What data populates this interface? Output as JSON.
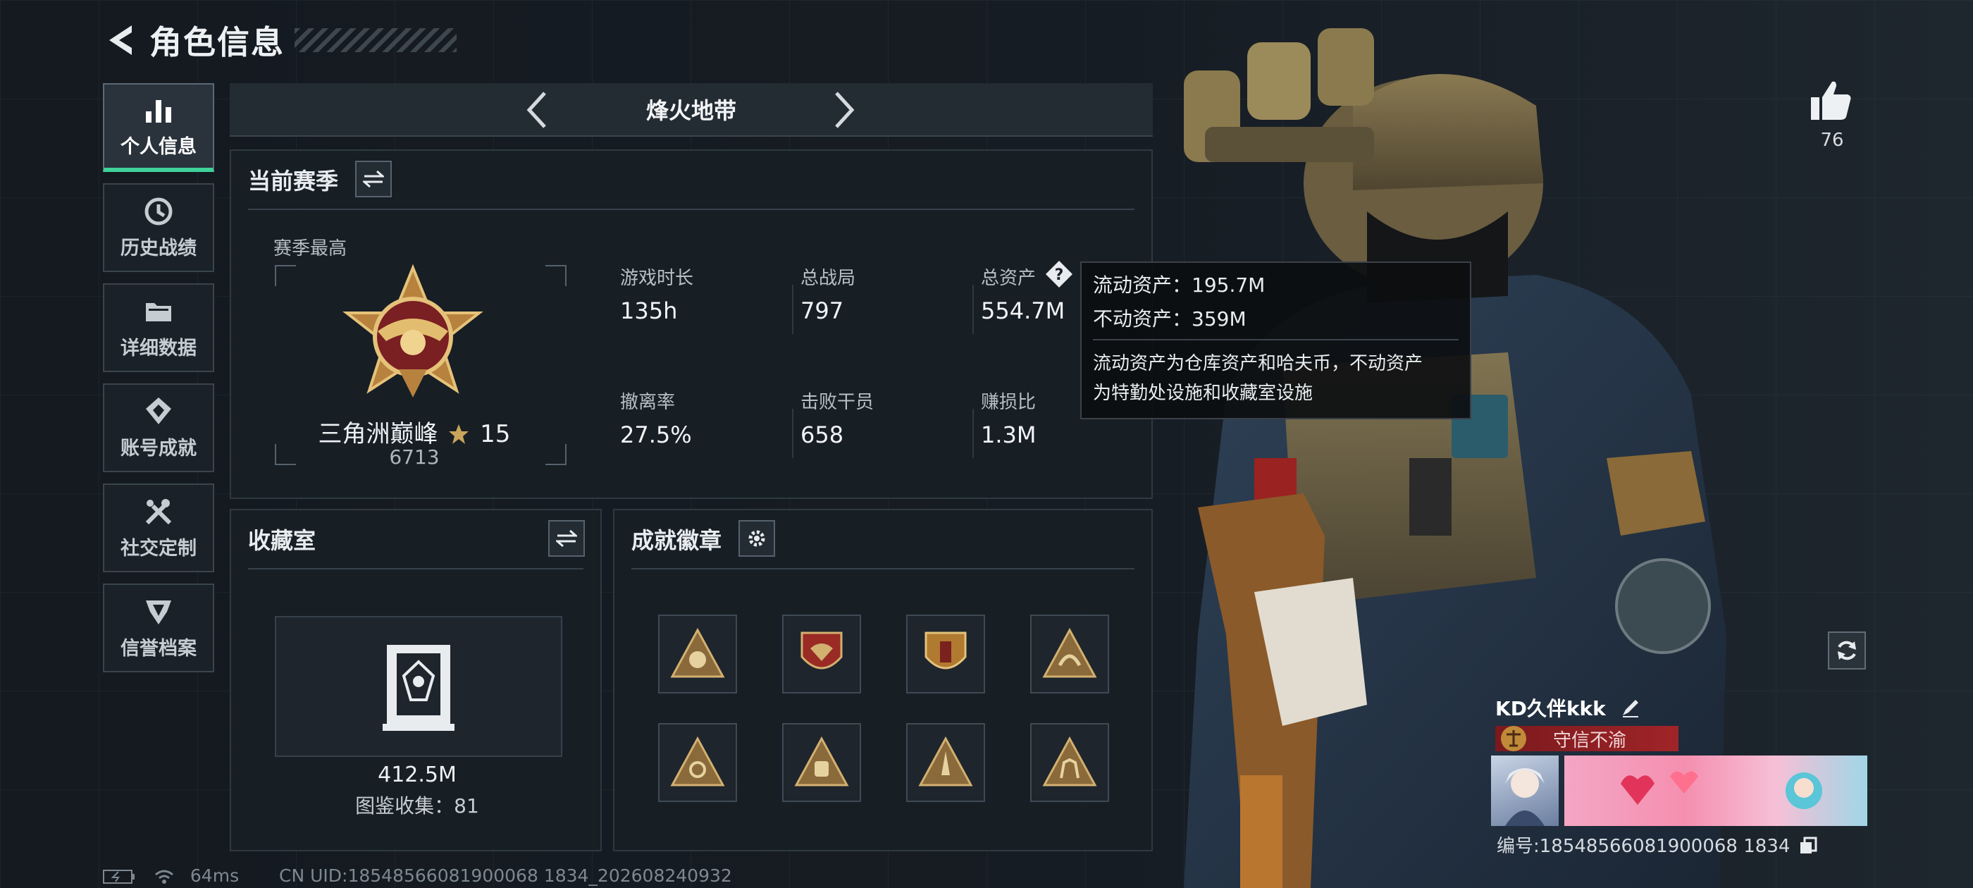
{
  "header": {
    "title": "角色信息"
  },
  "sidebar": {
    "items": [
      {
        "label": "个人信息",
        "icon": "bar-chart-icon",
        "active": true
      },
      {
        "label": "历史战绩",
        "icon": "history-icon",
        "active": false
      },
      {
        "label": "详细数据",
        "icon": "folder-icon",
        "active": false
      },
      {
        "label": "账号成就",
        "icon": "achievement-icon",
        "active": false
      },
      {
        "label": "社交定制",
        "icon": "tools-icon",
        "active": false
      },
      {
        "label": "信誉档案",
        "icon": "reputation-icon",
        "active": false
      }
    ]
  },
  "map_selector": {
    "name": "烽火地带"
  },
  "season": {
    "title": "当前赛季",
    "best_label": "赛季最高",
    "rank_name": "三角洲巅峰",
    "rank_stars": "15",
    "rank_score": "6713",
    "stats": [
      {
        "label": "游戏时长",
        "value": "135h"
      },
      {
        "label": "总战局",
        "value": "797"
      },
      {
        "label": "总资产",
        "value": "554.7M"
      },
      {
        "label": "撤离率",
        "value": "27.5%"
      },
      {
        "label": "击败干员",
        "value": "658"
      },
      {
        "label": "赚损比",
        "value": "1.3M"
      }
    ]
  },
  "tooltip": {
    "liquid": "流动资产：195.7M",
    "fixed": "不动资产：359M",
    "desc_line1": "流动资产为仓库资产和哈夫币，不动资产",
    "desc_line2": "为特勤处设施和收藏室设施"
  },
  "collection": {
    "title": "收藏室",
    "value": "412.5M",
    "count_text": "图鉴收集：81"
  },
  "achievements": {
    "title": "成就徽章",
    "badges": [
      "triangle-skull-badge",
      "shield-eagle-badge",
      "shield-emblem-badge",
      "triangle-dragon-badge",
      "triangle-beast-badge",
      "triangle-fist-badge",
      "triangle-rocket-badge",
      "triangle-soldiers-badge"
    ]
  },
  "profile": {
    "likes": "76",
    "player_name": "KD久伴kkk",
    "reputation_tag": "守信不渝",
    "player_id": "编号:18548566081900068 1834"
  },
  "footer": {
    "ping": "64ms",
    "uid": "CN UID:18548566081900068 1834_202608240932"
  },
  "colors": {
    "accent": "#3fd29a",
    "gold": "#c9a45a",
    "tag_red": "#a02428"
  }
}
